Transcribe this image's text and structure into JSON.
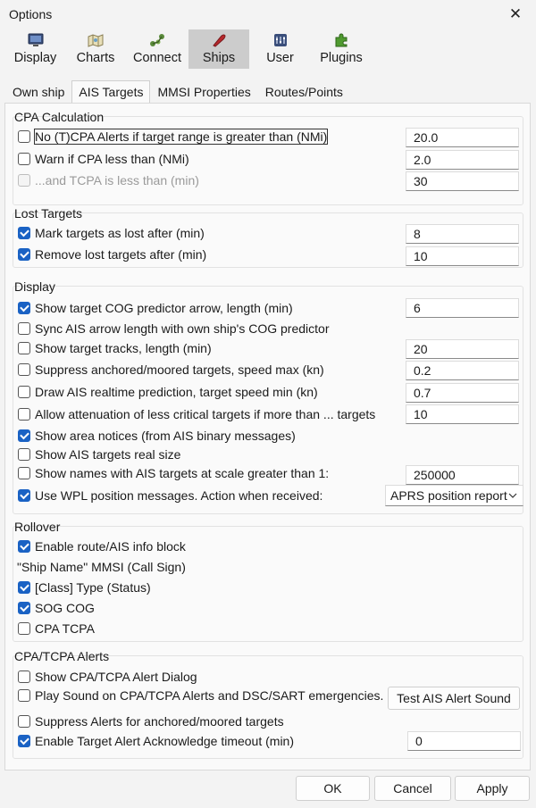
{
  "window": {
    "title": "Options",
    "close_glyph": "✕"
  },
  "toolbar": {
    "items": [
      {
        "label": "Display",
        "icon": "display-icon"
      },
      {
        "label": "Charts",
        "icon": "charts-icon"
      },
      {
        "label": "Connect",
        "icon": "connect-icon"
      },
      {
        "label": "Ships",
        "icon": "ships-icon",
        "active": true
      },
      {
        "label": "User",
        "icon": "user-icon"
      },
      {
        "label": "Plugins",
        "icon": "plugins-icon"
      }
    ]
  },
  "tabs": [
    {
      "label": "Own ship"
    },
    {
      "label": "AIS Targets",
      "active": true
    },
    {
      "label": "MMSI Properties"
    },
    {
      "label": "Routes/Points"
    }
  ],
  "cpa": {
    "title": "CPA Calculation",
    "no_alerts": {
      "label": "No (T)CPA Alerts if target range is greater than (NMi)",
      "checked": false,
      "value": "20.0"
    },
    "warn_cpa": {
      "label": "Warn if CPA less than (NMi)",
      "checked": false,
      "value": "2.0"
    },
    "tcpa": {
      "label": "...and TCPA is less than (min)",
      "checked": false,
      "disabled": true,
      "value": "30"
    }
  },
  "lost": {
    "title": "Lost Targets",
    "mark_lost": {
      "label": "Mark targets as lost after (min)",
      "checked": true,
      "value": "8"
    },
    "remove_lost": {
      "label": "Remove lost targets after (min)",
      "checked": true,
      "value": "10"
    }
  },
  "display": {
    "title": "Display",
    "cog_arrow": {
      "label": "Show target COG predictor arrow, length (min)",
      "checked": true,
      "value": "6"
    },
    "sync_arrow": {
      "label": "Sync AIS arrow length with own ship's COG predictor",
      "checked": false
    },
    "tracks": {
      "label": "Show target tracks, length (min)",
      "checked": false,
      "value": "20"
    },
    "suppress_anchored": {
      "label": "Suppress anchored/moored targets, speed max (kn)",
      "checked": false,
      "value": "0.2"
    },
    "realtime_pred": {
      "label": "Draw AIS realtime prediction, target speed min (kn)",
      "checked": false,
      "value": "0.7"
    },
    "attenuation": {
      "label": "Allow attenuation of less critical targets if more than ... targets",
      "checked": false,
      "value": "10"
    },
    "area_notices": {
      "label": "Show area notices (from AIS binary messages)",
      "checked": true
    },
    "real_size": {
      "label": "Show AIS targets real size",
      "checked": false
    },
    "names_scale": {
      "label": "Show names with AIS targets at scale greater than 1:",
      "checked": false,
      "value": "250000"
    },
    "wpl": {
      "label": "Use WPL position messages. Action when received:",
      "checked": true,
      "selected": "APRS position report"
    }
  },
  "rollover": {
    "title": "Rollover",
    "enable_block": {
      "label": "Enable route/AIS info block",
      "checked": true
    },
    "ship_name_label": "\"Ship Name\" MMSI (Call Sign)",
    "class_type": {
      "label": "[Class] Type (Status)",
      "checked": true
    },
    "sog_cog": {
      "label": "SOG COG",
      "checked": true
    },
    "cpa_tcpa": {
      "label": "CPA TCPA",
      "checked": false
    }
  },
  "alerts": {
    "title": "CPA/TCPA Alerts",
    "show_dialog": {
      "label": "Show CPA/TCPA Alert Dialog",
      "checked": false
    },
    "play_sound": {
      "label": "Play Sound on CPA/TCPA Alerts and DSC/SART emergencies.",
      "checked": false
    },
    "test_button": "Test AIS Alert Sound",
    "suppress_anchored": {
      "label": "Suppress Alerts for anchored/moored targets",
      "checked": false
    },
    "ack_timeout": {
      "label": "Enable Target Alert Acknowledge timeout (min)",
      "checked": true,
      "value": "0"
    }
  },
  "footer": {
    "ok": "OK",
    "cancel": "Cancel",
    "apply": "Apply"
  },
  "colors": {
    "accent": "#1a62c4",
    "active_tool": "#cccccc"
  }
}
